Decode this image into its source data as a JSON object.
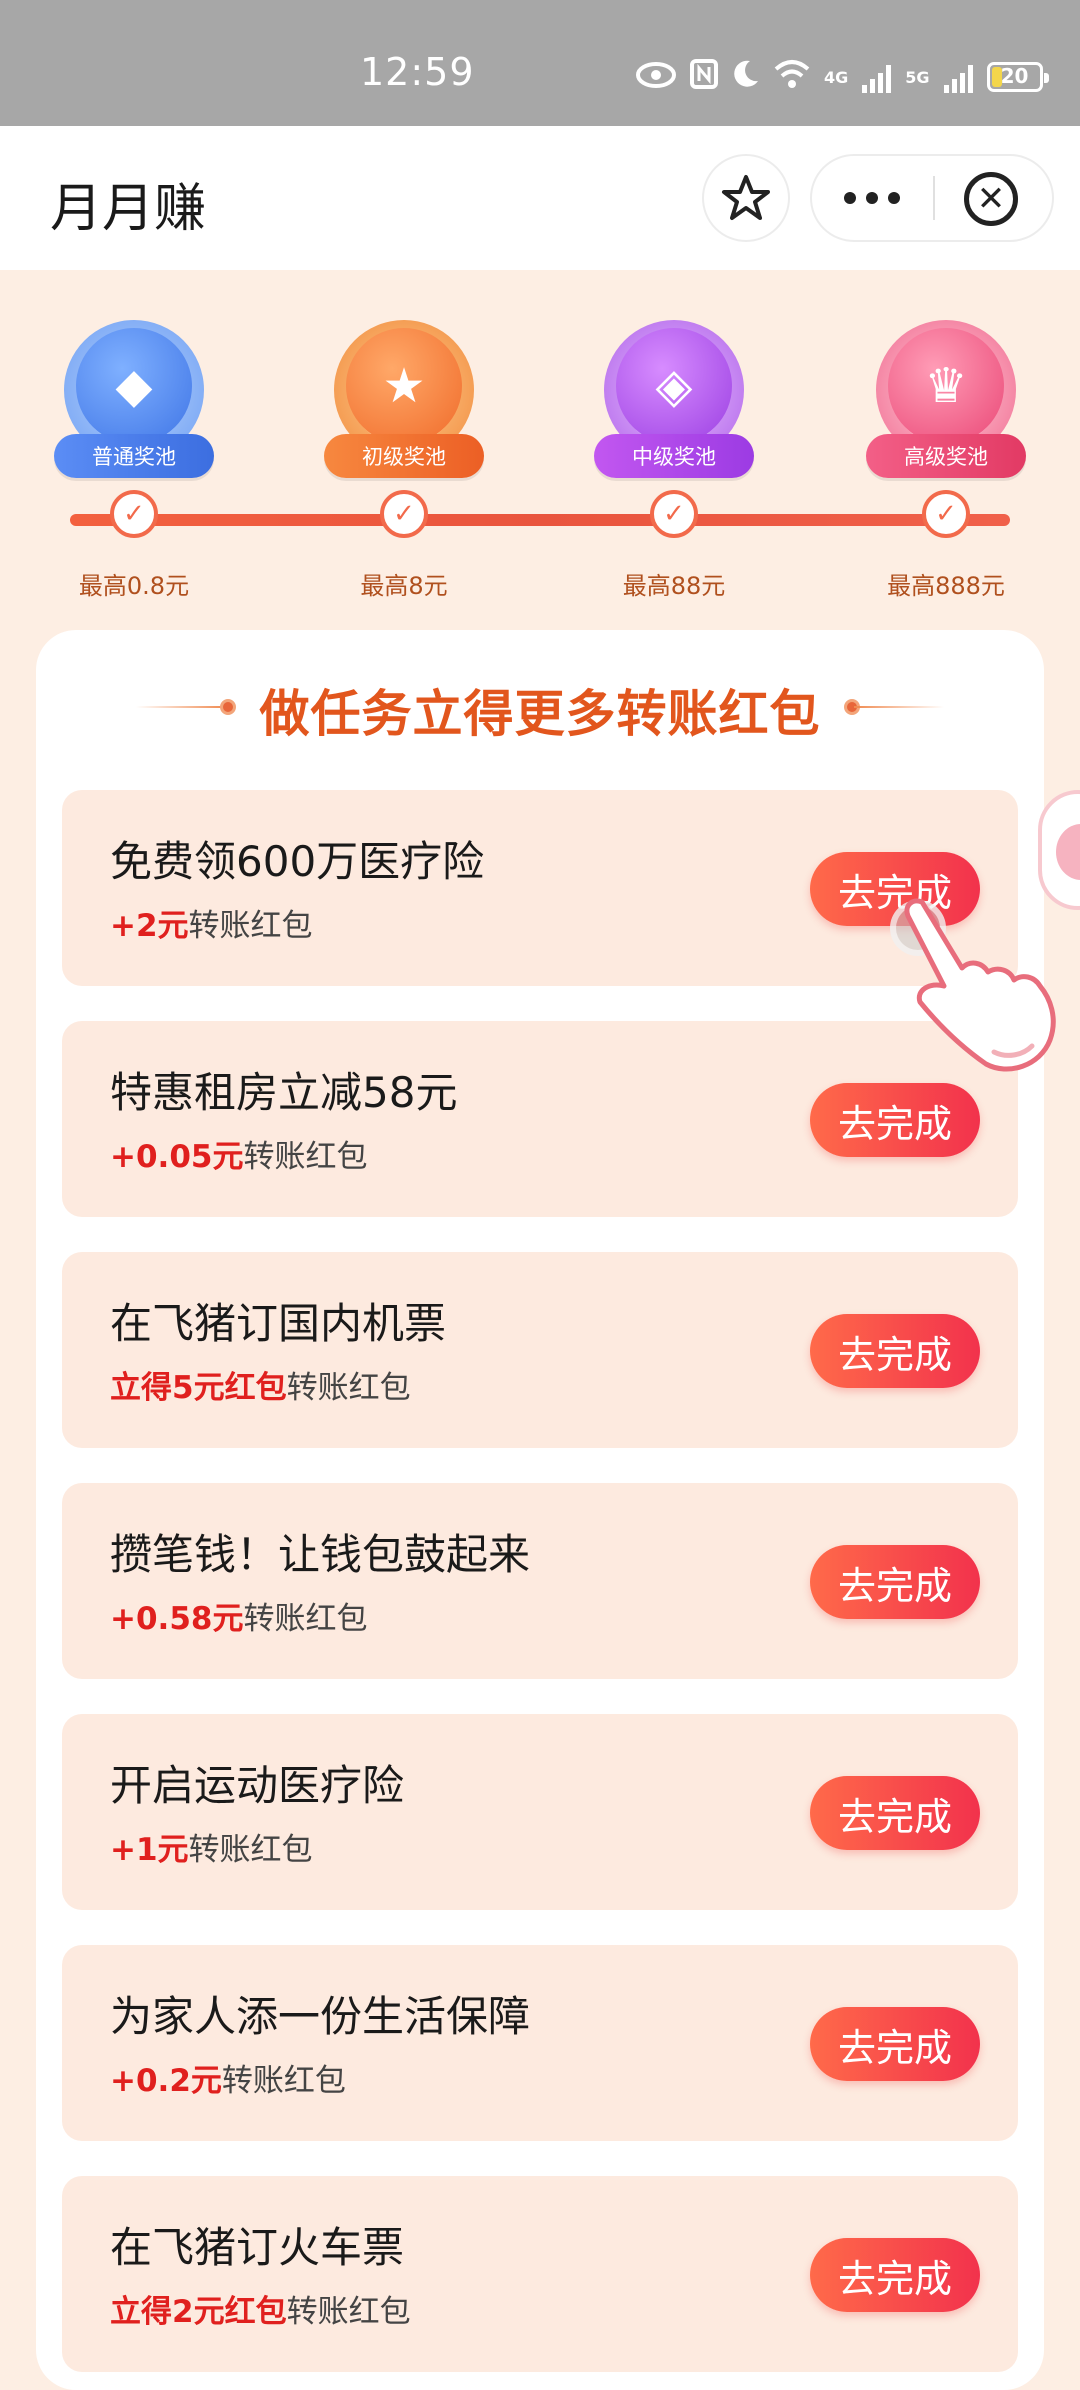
{
  "status_bar": {
    "time": "12:59",
    "battery": "20",
    "net1": "4G",
    "net2": "5G",
    "icons": [
      "eye-icon",
      "nfc-icon",
      "moon-icon",
      "wifi-icon",
      "signal-icon",
      "signal-icon",
      "battery-icon"
    ]
  },
  "header": {
    "title": "月月赚",
    "icons": [
      "star-icon",
      "more-icon",
      "close-icon"
    ]
  },
  "tiers": [
    {
      "label": "普通奖池",
      "max": "最高0.8元",
      "color": "#4f86f0",
      "icon": "diamond-medal-icon"
    },
    {
      "label": "初级奖池",
      "max": "最高8元",
      "color": "#f2743a",
      "icon": "star-medal-icon"
    },
    {
      "label": "中级奖池",
      "max": "最高88元",
      "color": "#b34be8",
      "icon": "gem-medal-icon"
    },
    {
      "label": "高级奖池",
      "max": "最高888元",
      "color": "#f0507a",
      "icon": "crown-medal-icon"
    }
  ],
  "panel": {
    "title": "做任务立得更多转账红包"
  },
  "tasks": [
    {
      "title": "免费领600万医疗险",
      "reward_amount": "+2元",
      "reward_suffix": "转账红包",
      "button": "去完成"
    },
    {
      "title": "特惠租房立减58元",
      "reward_amount": "+0.05元",
      "reward_suffix": "转账红包",
      "button": "去完成"
    },
    {
      "title": "在飞猪订国内机票",
      "reward_amount": "立得5元红包",
      "reward_suffix": "转账红包",
      "button": "去完成"
    },
    {
      "title": "攒笔钱！让钱包鼓起来",
      "reward_amount": "+0.58元",
      "reward_suffix": "转账红包",
      "button": "去完成"
    },
    {
      "title": "开启运动医疗险",
      "reward_amount": "+1元",
      "reward_suffix": "转账红包",
      "button": "去完成"
    },
    {
      "title": "为家人添一份生活保障",
      "reward_amount": "+0.2元",
      "reward_suffix": "转账红包",
      "button": "去完成"
    },
    {
      "title": "在飞猪订火车票",
      "reward_amount": "立得2元红包",
      "reward_suffix": "转账红包",
      "button": "去完成"
    }
  ],
  "colors": {
    "accent": "#e2561d",
    "reward": "#e0201e",
    "button_start": "#ff6a4a",
    "button_end": "#f2324c",
    "page_bg": "#fdeee3"
  }
}
